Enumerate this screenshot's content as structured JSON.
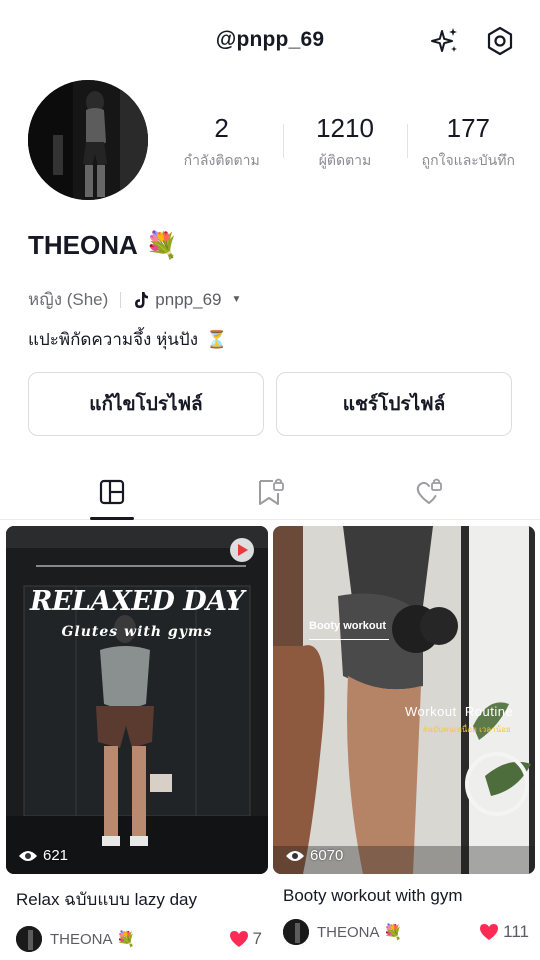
{
  "header": {
    "username": "@pnpp_69",
    "sparkle_icon": "sparkle-icon",
    "settings_icon": "hexagon-settings-icon"
  },
  "profile": {
    "display_name": "THEONA",
    "name_emoji": "💐",
    "pronoun": "หญิง (She)",
    "tiktok_handle": "pnpp_69",
    "bio": "แปะพิกัดความจึ้ง หุ่นปัง",
    "bio_emoji": "⏳"
  },
  "stats": [
    {
      "value": "2",
      "label": "กำลังติดตาม"
    },
    {
      "value": "1210",
      "label": "ผู้ติดตาม"
    },
    {
      "value": "177",
      "label": "ถูกใจและบันทึก"
    }
  ],
  "buttons": {
    "edit": "แก้ไขโปรไฟล์",
    "share": "แชร์โปรไฟล์"
  },
  "tabs": [
    {
      "name": "grid",
      "icon": "grid-icon",
      "active": true
    },
    {
      "name": "saved",
      "icon": "bookmark-lock-icon",
      "active": false
    },
    {
      "name": "liked",
      "icon": "heart-lock-icon",
      "active": false
    }
  ],
  "posts": [
    {
      "overlay_title": "RELAXED DAY",
      "overlay_subtitle": "Glutes with gyms",
      "views": "621",
      "title": "Relax ฉบับแบบ lazy day",
      "author": "THEONA",
      "author_emoji": "💐",
      "likes": "7"
    },
    {
      "overlay_label": "Booty workout",
      "overlay_title": "Workout  Routine",
      "overlay_subtitle": "#ฉบับคนเหนื่อย เวลาน้อย",
      "views": "6070",
      "title": "Booty workout with gym",
      "author": "THEONA",
      "author_emoji": "💐",
      "likes": "111"
    }
  ],
  "colors": {
    "text": "#161823",
    "muted": "#8a8b91",
    "heart": "#fe2c55",
    "overlay_yellow": "#f2c744"
  }
}
